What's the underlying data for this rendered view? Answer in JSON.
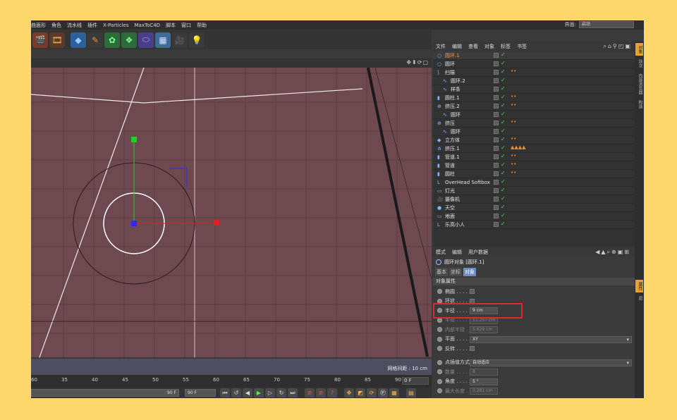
{
  "menu": [
    "曲面形",
    "角色",
    "流水线",
    "插件",
    "X-Particles",
    "MaxToC4D",
    "脚本",
    "窗口",
    "帮助"
  ],
  "layout_label": "界面:",
  "layout_value": "启动",
  "toolbar_icons": [
    "render-view-icon",
    "render-settings-icon",
    "cube-icon",
    "pen-icon",
    "subdivide-icon",
    "array-icon",
    "deformer-icon",
    "floor-icon",
    "camera-icon",
    "light-icon"
  ],
  "viewport": {
    "grid_spacing_label": "网格间距 : 10 cm",
    "colors": {
      "bg": "#6e4a50",
      "grid": "#5a3c42",
      "axis_x": "#e02020",
      "axis_y": "#20d020",
      "wire": "#f0e8ea"
    }
  },
  "timeline": {
    "ticks": [
      "60",
      "35",
      "40",
      "45",
      "50",
      "55",
      "60",
      "65",
      "70",
      "75",
      "80",
      "85",
      "90"
    ],
    "frame": "0 F",
    "end_frame": "90 F",
    "current_frame": "90 F"
  },
  "object_manager": {
    "menu": [
      "文件",
      "编辑",
      "查看",
      "对象",
      "标签",
      "书签"
    ],
    "rows": [
      {
        "name": "圆环.1",
        "selected": true,
        "tags": ""
      },
      {
        "name": "圆环",
        "tags": ""
      },
      {
        "name": "扫描",
        "tags": "••"
      },
      {
        "name": "圆环.2",
        "tags": ""
      },
      {
        "name": "样条",
        "tags": ""
      },
      {
        "name": "圆柱.1",
        "tags": "••"
      },
      {
        "name": "挤压.2",
        "tags": "••"
      },
      {
        "name": "圆环",
        "tags": ""
      },
      {
        "name": "挤压",
        "tags": "••"
      },
      {
        "name": "圆环",
        "tags": ""
      },
      {
        "name": "立方体",
        "tags": "••"
      },
      {
        "name": "挤压.1",
        "tags": "▲▲▲▲"
      },
      {
        "name": "管道.1",
        "tags": "••"
      },
      {
        "name": "管道",
        "tags": "••"
      },
      {
        "name": "圆柱",
        "tags": "••"
      },
      {
        "name": "OverHead Softbox",
        "tags": ""
      },
      {
        "name": "灯光",
        "tags": ""
      },
      {
        "name": "摄像机",
        "tags": ""
      },
      {
        "name": "天空",
        "tags": ""
      },
      {
        "name": "地面",
        "tags": ""
      },
      {
        "name": "乐高小人",
        "tags": ""
      }
    ]
  },
  "side_tabs_top": [
    "对象",
    "场次",
    "内容浏览器",
    "构造"
  ],
  "side_tabs_bottom": [
    "属性",
    "层"
  ],
  "attributes": {
    "menu": [
      "模式",
      "编辑",
      "用户数据"
    ],
    "title": "圆环对象 [圆环.1]",
    "tabs": [
      "基本",
      "坐标",
      "对象"
    ],
    "active_tab": "对象",
    "section": "对象属性",
    "props": [
      {
        "label": "椭圆 . . . . .",
        "type": "check"
      },
      {
        "label": "环状 . . . . .",
        "type": "check"
      },
      {
        "label": "半径 . . . . .",
        "type": "field",
        "value": "9 cm"
      },
      {
        "label": "半径 . . . . .",
        "type": "field",
        "value": "11.257 cm",
        "dim": true
      },
      {
        "label": "内部半径 . . .",
        "type": "field",
        "value": "5.629 cm",
        "dim": true
      },
      {
        "label": "平面 . . . . .",
        "type": "select",
        "value": "XY"
      },
      {
        "label": "反转 . . . . .",
        "type": "check"
      },
      {
        "label": "点插值方式",
        "type": "select",
        "value": "自动适应"
      },
      {
        "label": "数量 . . . . .",
        "type": "field",
        "value": "8",
        "dim": true
      },
      {
        "label": "角度 . . . . .",
        "type": "field",
        "value": "5 °"
      },
      {
        "label": "最大长度 . . .",
        "type": "field",
        "value": "0.281 cm",
        "dim": true
      }
    ]
  },
  "highlight_color": "#d92b2b"
}
